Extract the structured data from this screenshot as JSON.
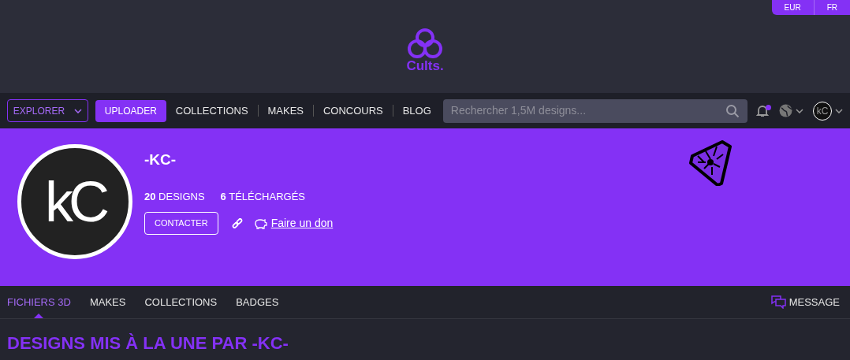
{
  "currency_switch": [
    {
      "label": "EUR"
    },
    {
      "label": "FR"
    }
  ],
  "logo": {
    "text": "Cults."
  },
  "nav": {
    "explore": "EXPLORER",
    "upload": "UPLOADER",
    "links": [
      {
        "label": "COLLECTIONS"
      },
      {
        "label": "MAKES"
      },
      {
        "label": "CONCOURS"
      },
      {
        "label": "BLOG"
      }
    ],
    "search": {
      "placeholder": "Rechercher 1,5M designs..."
    },
    "notification_unread": true,
    "user_avatar": "kC"
  },
  "profile": {
    "avatar_text": "kC",
    "name": "-KC-",
    "stats": [
      "**20** DESIGNS",
      "**6** TÉLÉCHARGÉS"
    ],
    "contact": "CONTACTER",
    "donate": "Faire un don"
  },
  "tabs": [
    {
      "label": "FICHIERS 3D",
      "selected": true
    },
    {
      "label": "MAKES",
      "selected": false
    },
    {
      "label": "COLLECTIONS",
      "selected": false
    },
    {
      "label": "BADGES",
      "selected": false
    }
  ],
  "message": "MESSAGE",
  "heading": "DESIGNS MIS À LA UNE PAR -KC-"
}
